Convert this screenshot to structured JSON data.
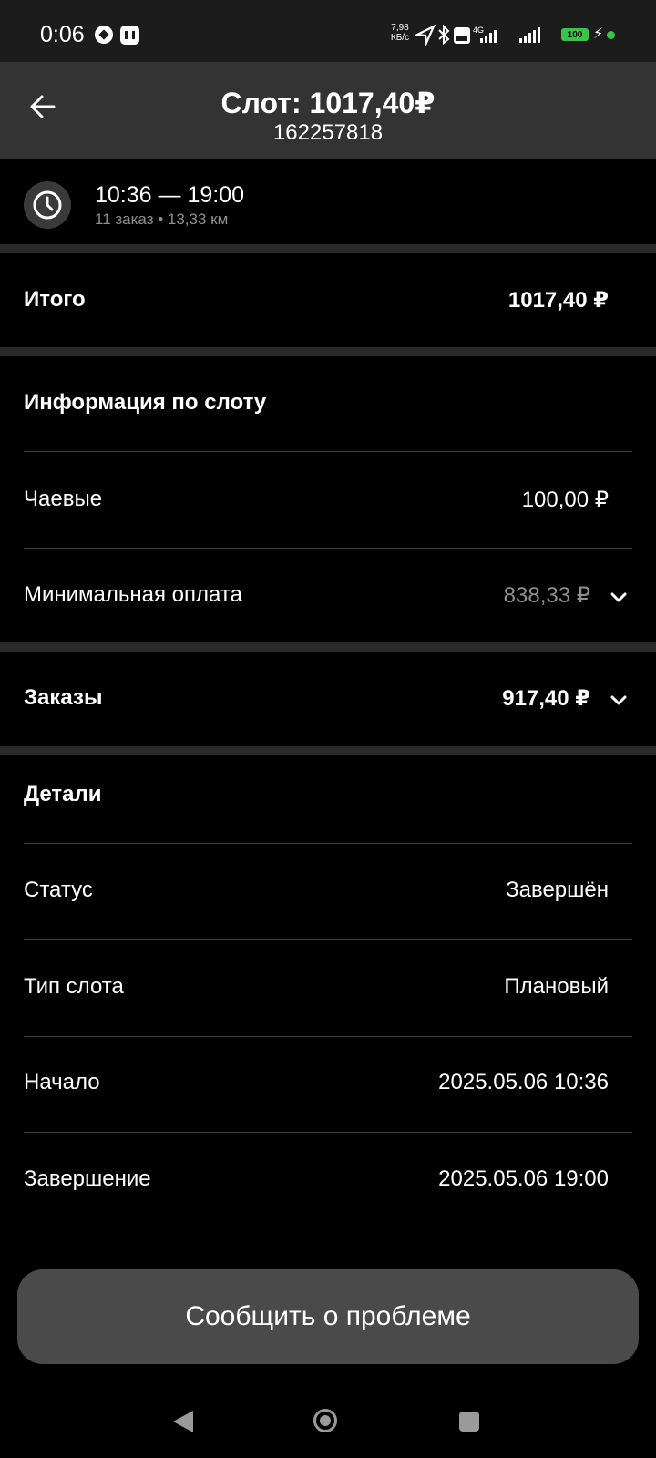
{
  "status_bar": {
    "time": "0:06",
    "speed_value": "7,98",
    "speed_unit": "КБ/с",
    "network": "4G",
    "battery": "100"
  },
  "header": {
    "title": "Слот: 1017,40₽",
    "subtitle": "162257818"
  },
  "slot": {
    "time_range": "10:36 — 19:00",
    "meta": "11 заказ • 13,33 км"
  },
  "total": {
    "label": "Итого",
    "value": "1017,40 ₽"
  },
  "slot_info": {
    "title": "Информация по слоту",
    "tips_label": "Чаевые",
    "tips_value": "100,00 ₽",
    "min_pay_label": "Минимальная оплата",
    "min_pay_value": "838,33 ₽"
  },
  "orders": {
    "label": "Заказы",
    "value": "917,40 ₽"
  },
  "details": {
    "title": "Детали",
    "rows": [
      {
        "label": "Статус",
        "value": "Завершён"
      },
      {
        "label": "Тип слота",
        "value": "Плановый"
      },
      {
        "label": "Начало",
        "value": "2025.05.06 10:36"
      },
      {
        "label": "Завершение",
        "value": "2025.05.06 19:00"
      }
    ]
  },
  "actions": {
    "report_label": "Сообщить о проблеме"
  },
  "colors": {
    "background": "#000000",
    "header_bg": "#333333",
    "separator": "#2a2a2a",
    "muted_text": "#8e8e8e",
    "button_bg": "#4a4a4a",
    "battery_green": "#3ec14b"
  }
}
